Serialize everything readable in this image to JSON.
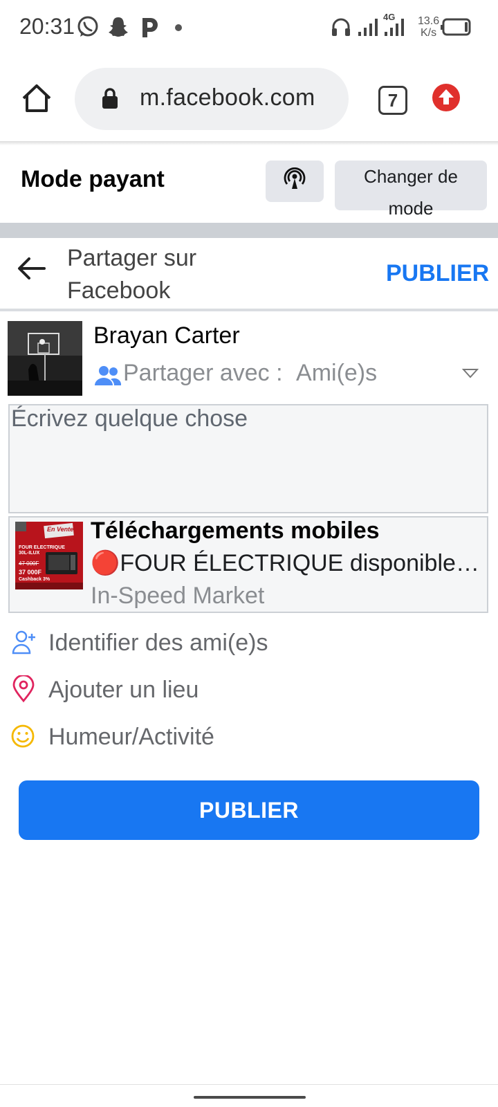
{
  "status_bar": {
    "time": "20:31",
    "network_label": "4G",
    "speed_value": "13.6",
    "speed_unit": "K/s",
    "icons": [
      "whatsapp-icon",
      "snapchat-icon",
      "p-app-icon",
      "dot-icon",
      "headphones-icon",
      "signal-icon",
      "signal-4g-icon",
      "battery-icon"
    ]
  },
  "browser": {
    "url": "m.facebook.com",
    "tab_count": "7",
    "icons": [
      "home-icon",
      "lock-icon",
      "update-icon"
    ]
  },
  "mode_bar": {
    "title": "Mode payant",
    "change_mode_label_line1": "Changer de",
    "change_mode_label_line2": "mode",
    "icon": "broadcast-icon"
  },
  "header": {
    "title_line1": "Partager sur",
    "title_line2": "Facebook",
    "publish_label": "PUBLIER"
  },
  "user": {
    "name": "Brayan Carter",
    "share_prefix": "Partager avec :",
    "share_audience": "Ami(e)s"
  },
  "composer": {
    "placeholder": "Écrivez quelque chose"
  },
  "link_preview": {
    "title": "Téléchargements mobiles",
    "description": "🔴FOUR ÉLECTRIQUE disponible chez In-Speed Market",
    "site": "In-Speed Market",
    "thumb_text": {
      "brand": "En Vente",
      "line1": "FOUR ELECTRIQUE",
      "line2": "30L-ILUX",
      "price1": "47 000F",
      "price2": "37 000F",
      "cashback": "Cashback 3%"
    }
  },
  "options": [
    {
      "label": "Identifier des ami(e)s",
      "icon": "tag-friends-icon"
    },
    {
      "label": "Ajouter un lieu",
      "icon": "location-pin-icon"
    },
    {
      "label": "Humeur/Activité",
      "icon": "smiley-icon"
    }
  ],
  "publish_button_label": "PUBLIER",
  "colors": {
    "accent": "#1877f2",
    "update_red": "#e0302c",
    "pin_pink": "#e0245e",
    "smiley_yellow": "#f5b800"
  }
}
